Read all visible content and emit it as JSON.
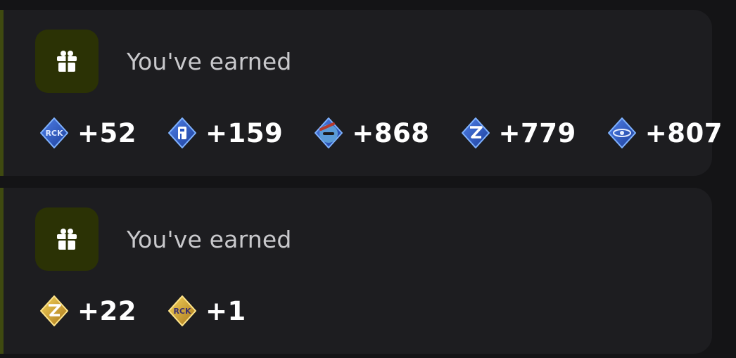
{
  "cards": [
    {
      "headline": "You've earned",
      "icon": "gift-icon",
      "rewards": [
        {
          "token": "rck-badge-token",
          "style": "blue",
          "amount": "+52"
        },
        {
          "token": "r-shield-token",
          "style": "blue",
          "amount": "+159"
        },
        {
          "token": "pepe-face-token",
          "style": "blue",
          "amount": "+868"
        },
        {
          "token": "z-bolt-token",
          "style": "blue",
          "amount": "+779"
        },
        {
          "token": "ring-orbit-token",
          "style": "blue",
          "amount": "+807"
        }
      ]
    },
    {
      "headline": "You've earned",
      "icon": "gift-icon",
      "rewards": [
        {
          "token": "z-bolt-token",
          "style": "gold",
          "amount": "+22"
        },
        {
          "token": "rck-badge-token",
          "style": "gold",
          "amount": "+1"
        }
      ]
    }
  ],
  "colors": {
    "accent_bar": "#3f4a10",
    "gift_tile": "#2b3205",
    "card_bg": "#1d1d20",
    "page_bg": "#141416"
  }
}
